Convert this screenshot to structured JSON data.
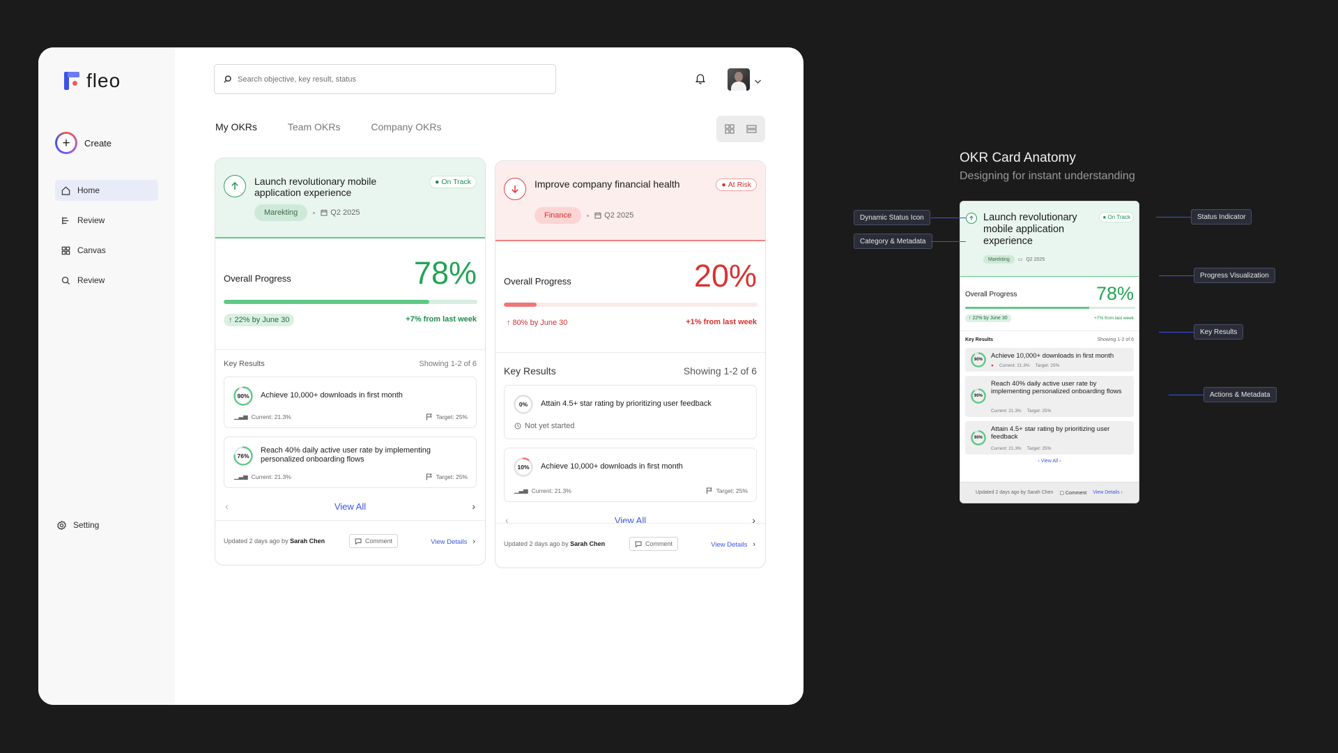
{
  "brand": {
    "name": "fleo"
  },
  "sidebar": {
    "create_label": "Create",
    "items": [
      {
        "label": "Home",
        "icon": "home-icon"
      },
      {
        "label": "Review",
        "icon": "review-icon"
      },
      {
        "label": "Canvas",
        "icon": "canvas-icon"
      },
      {
        "label": "Review",
        "icon": "search-icon"
      }
    ],
    "setting_label": "Setting"
  },
  "search": {
    "placeholder": "Search objective, key result, status",
    "value": ""
  },
  "tabs": [
    {
      "label": "My OKRs",
      "active": true
    },
    {
      "label": "Team OKRs",
      "active": false
    },
    {
      "label": "Company OKRs",
      "active": false
    }
  ],
  "cards": [
    {
      "title": "Launch revolutionary mobile application experience",
      "status": "On Track",
      "category": "Marekting",
      "quarter": "Q2 2025",
      "progress_label": "Overall Progress",
      "progress_pct": "78%",
      "progress_fraction": 0.81,
      "goal_note": "22% by June 30",
      "delta": "+7% from last week",
      "kr_title": "Key Results",
      "kr_count": "Showing 1-2 of 6",
      "key_results": [
        {
          "ring": "90%",
          "fraction": 0.9,
          "text": "Achieve 10,000+ downloads in first month",
          "current": "Current: 21.3%",
          "target": "Target: 25%"
        },
        {
          "ring": "76%",
          "fraction": 0.76,
          "text": "Reach 40% daily active user rate by implementing personalized onboarding flows",
          "current": "Current: 21.3%",
          "target": "Target: 25%"
        }
      ],
      "view_all": "View All",
      "updated_prefix": "Updated 2 days ago by",
      "updated_by": "Sarah Chen",
      "comment": "Comment",
      "view_details": "View Details"
    },
    {
      "title": "Improve company financial health",
      "status": "At Risk",
      "category": "Finance",
      "quarter": "Q2 2025",
      "progress_label": "Overall Progress",
      "progress_pct": "20%",
      "progress_fraction": 0.13,
      "goal_note": "80% by June 30",
      "delta": "+1% from last week",
      "kr_title": "Key Results",
      "kr_count": "Showing 1-2 of 6",
      "key_results": [
        {
          "ring": "0%",
          "fraction": 0,
          "text": "Attain 4.5+ star rating by prioritizing user feedback",
          "status": "Not yet started"
        },
        {
          "ring": "10%",
          "fraction": 0.1,
          "text": "Achieve 10,000+ downloads in first month",
          "current": "Current: 21.3%",
          "target": "Target: 25%"
        }
      ],
      "view_all": "View All",
      "updated_prefix": "Updated 2 days ago by",
      "updated_by": "Sarah Chen",
      "comment": "Comment",
      "view_details": "View Details"
    }
  ],
  "anatomy": {
    "title": "OKR Card Anatomy",
    "subtitle": "Designing for instant understanding",
    "card": {
      "title": "Launch revolutionary mobile application experience",
      "status": "On Track",
      "category": "Marekting",
      "quarter": "Q2 2025",
      "progress_label": "Overall Progress",
      "progress_pct": "78%",
      "progress_fraction": 0.73,
      "goal_note": "22% by June 30",
      "delta": "+7% from last week",
      "kr_title": "Key Results",
      "kr_count": "Showing 1-2 of 6",
      "key_results": [
        {
          "ring": "90%",
          "text": "Achieve 10,000+ downloads in first month",
          "current": "Current: 21.3%",
          "target": "Target: 25%"
        },
        {
          "ring": "90%",
          "text": "Reach 40% daily active user rate by implementing personalized onboarding flows",
          "current": "Current: 21.3%",
          "target": "Target: 25%"
        },
        {
          "ring": "90%",
          "text": "Attain 4.5+ star rating by prioritizing user feedback",
          "current": "Current: 21.3%",
          "target": "Target: 25%"
        }
      ],
      "view_all": "View All",
      "updated": "Updated 2 days ago by Sarah Chen",
      "comment": "Comment",
      "view_details": "View Details"
    },
    "labels": {
      "status_icon": "Dynamic Status Icon",
      "category": "Category & Metadata",
      "status_indicator": "Status Indicator",
      "progress": "Progress Visualization",
      "key_results": "Key Results",
      "actions": "Actions & Metadata"
    }
  },
  "colors": {
    "accent": "#3b54e4",
    "on_track": "#22a455",
    "at_risk": "#d93232",
    "background": "#1b1b1b"
  }
}
